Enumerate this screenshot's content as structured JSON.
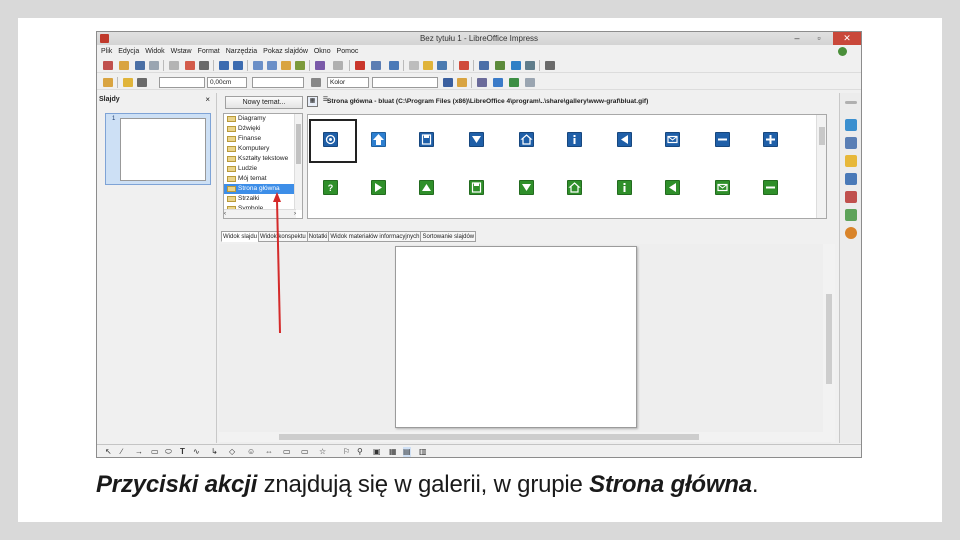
{
  "window": {
    "title": "Bez tytułu 1 - LibreOffice Impress",
    "minimize": "–",
    "maximize": "▫",
    "close": "✕"
  },
  "menu": [
    "Plik",
    "Edycja",
    "Widok",
    "Wstaw",
    "Format",
    "Narzędzia",
    "Pokaz slajdów",
    "Okno",
    "Pomoc"
  ],
  "toolbar2": {
    "line_width": "0,00cm",
    "area_style": "Kolor"
  },
  "slides_pane": {
    "title": "Slajdy",
    "close": "×",
    "slide_number": "1"
  },
  "gallery": {
    "new_theme_button": "Nowy temat...",
    "path": "Strona główna - bluat (C:\\Program Files (x86)\\LibreOffice 4\\program\\..\\share\\gallery\\www-graf\\bluat.gif)",
    "themes": [
      "Diagramy",
      "Dźwięki",
      "Finanse",
      "Komputery",
      "Kształty tekstowe",
      "Ludzie",
      "Mój temat",
      "Strona główna",
      "Strzałki",
      "Symbole"
    ],
    "selected_theme": "Strona główna",
    "row1_icons": [
      "at-icon",
      "home-arrow-icon",
      "save-icon",
      "down-icon",
      "home-icon",
      "info-icon",
      "left-icon",
      "mail-icon",
      "minus-icon",
      "plus-icon"
    ],
    "row2_icons": [
      "question-icon",
      "right-icon",
      "up-icon",
      "save-icon",
      "down-icon",
      "home-icon",
      "info-icon",
      "left-icon",
      "mail-icon",
      "minus-icon"
    ]
  },
  "view_tabs": [
    "Widok slajdu",
    "Widok konspektu",
    "Notatki",
    "Widok materiałów informacyjnych",
    "Sortowanie slajdów"
  ],
  "caption": {
    "bold1": "Przyciski akcji",
    "mid": " znajdują się w galerii, w grupie ",
    "bold2": "Strona główna",
    "end": "."
  },
  "colors": {
    "row1_icon": "#1f5fa8",
    "row2_icon": "#2f8f2a",
    "selection": "#3d8ee8",
    "arrow": "#d42a2a"
  }
}
